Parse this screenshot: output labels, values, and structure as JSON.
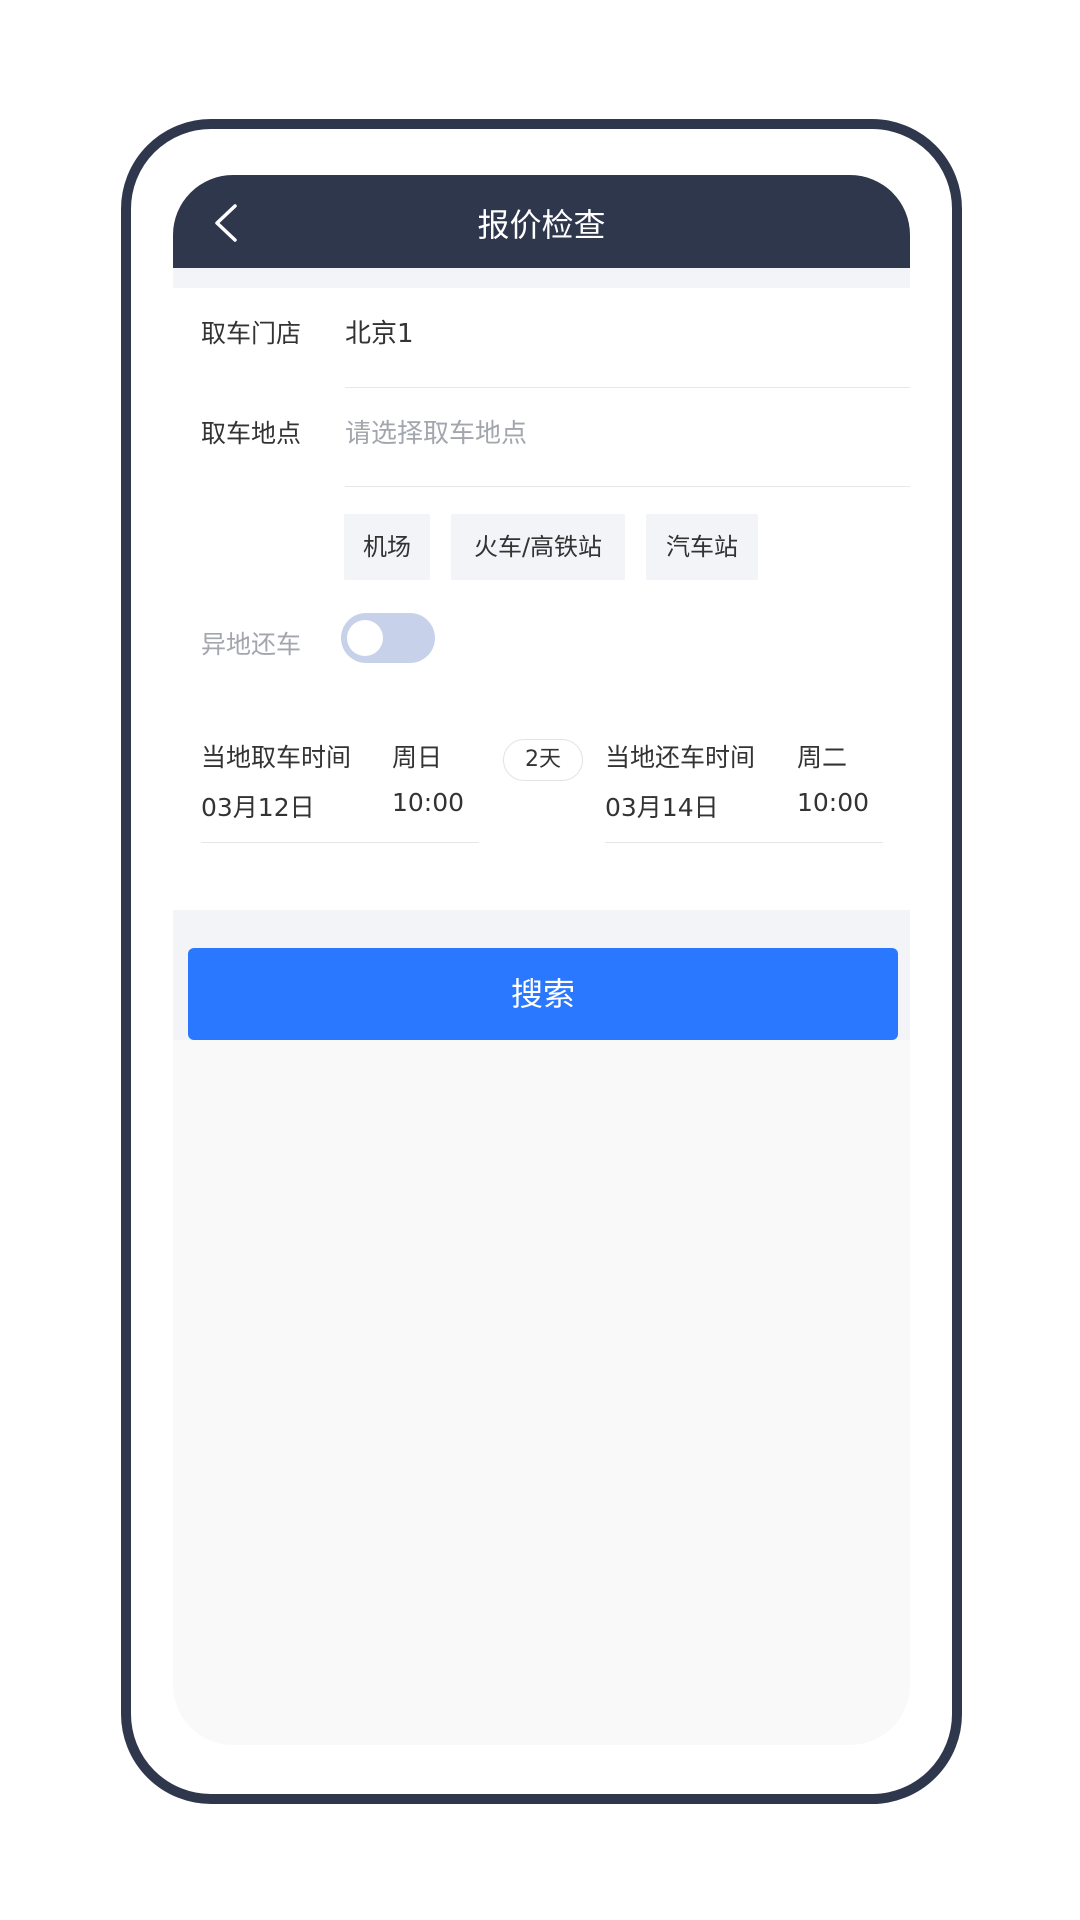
{
  "header": {
    "title": "报价检查",
    "back_icon": "chevron-left-icon",
    "background": "#2f374d"
  },
  "pickup_store": {
    "label": "取车门店",
    "value": "北京1"
  },
  "pickup_location": {
    "label": "取车地点",
    "placeholder": "请选择取车地点"
  },
  "quick_locations": [
    {
      "label": "机场"
    },
    {
      "label": "火车/高铁站"
    },
    {
      "label": "汽车站"
    }
  ],
  "different_return": {
    "label": "异地还车",
    "enabled": false
  },
  "pickup_time": {
    "label": "当地取车时间",
    "weekday": "周日",
    "date": "03月12日",
    "time": "10:00"
  },
  "duration": "2天",
  "return_time": {
    "label": "当地还车时间",
    "weekday": "周二",
    "date": "03月14日",
    "time": "10:00"
  },
  "search_button": {
    "label": "搜索",
    "color": "#2a78ff"
  }
}
